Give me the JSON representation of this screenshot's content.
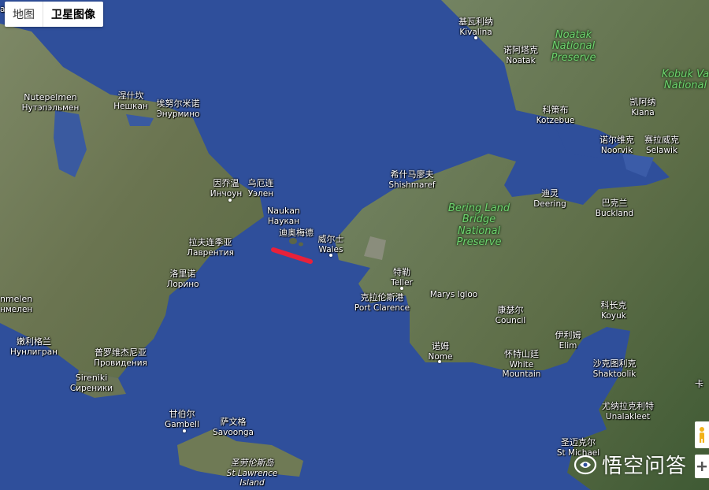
{
  "map_type_control": {
    "map_tab": "地图",
    "satellite_tab": "卫星图像",
    "active": "satellite"
  },
  "places": {
    "kivalina": {
      "zh": "基瓦利纳",
      "en": "Kivalina"
    },
    "noatak": {
      "zh": "诺阿塔克",
      "en": "Noatak"
    },
    "kotzebue": {
      "zh": "科策布",
      "en": "Kotzebue"
    },
    "kiana": {
      "zh": "凯阿纳",
      "en": "Kiana"
    },
    "noorvik": {
      "zh": "诺尔维克",
      "en": "Noorvik"
    },
    "selawik": {
      "zh": "赛拉威克",
      "en": "Selawik"
    },
    "shishmaref": {
      "zh": "希什马廖夫",
      "en": "Shishmaref"
    },
    "deering": {
      "zh": "迪灵",
      "en": "Deering"
    },
    "buckland": {
      "zh": "巴克兰",
      "en": "Buckland"
    },
    "wales": {
      "zh": "威尔士",
      "en": "Wales"
    },
    "teller": {
      "zh": "特勒",
      "en": "Teller"
    },
    "port_clarence": {
      "zh": "克拉伦斯港",
      "en": "Port Clarence"
    },
    "marys_igloo": {
      "zh": "",
      "en": "Marys Igloo"
    },
    "council": {
      "zh": "康瑟尔",
      "en": "Council"
    },
    "koyuk": {
      "zh": "科长克",
      "en": "Koyuk"
    },
    "elim": {
      "zh": "伊利姆",
      "en": "Elim"
    },
    "nome": {
      "zh": "诺姆",
      "en": "Nome"
    },
    "white_mountain": {
      "zh": "怀特山廷",
      "en": "White\nMountain"
    },
    "shaktoolik": {
      "zh": "沙克图利克",
      "en": "Shaktoolik"
    },
    "unalakleet": {
      "zh": "尤纳拉克利特",
      "en": "Unalakleet"
    },
    "st_michael": {
      "zh": "圣迈克尔",
      "en": "St Michael"
    },
    "nutepelmen": {
      "zh": "Nutepelmen",
      "en": "Нутэпэльмен"
    },
    "neshkan": {
      "zh": "涅什坎",
      "en": "Нешкан"
    },
    "enurmino": {
      "zh": "埃努尔米诺",
      "en": "Энурмино"
    },
    "inchoun": {
      "zh": "因乔温",
      "en": "Инчоун"
    },
    "uelen": {
      "zh": "乌厄连",
      "en": "Уэлен"
    },
    "naukan": {
      "zh": "Naukan",
      "en": "Наукан"
    },
    "diomede": {
      "zh": "迪奥梅德",
      "en": ""
    },
    "lavrentiya": {
      "zh": "拉夫连季亚",
      "en": "Лаврентия"
    },
    "lorino": {
      "zh": "洛里诺",
      "en": "Лорино"
    },
    "enmelen": {
      "zh": "nmelen",
      "en": "нмелен"
    },
    "nunligran": {
      "zh": "嫩利格兰",
      "en": "Нунлигран"
    },
    "provideniya": {
      "zh": "普罗维杰尼亚",
      "en": "Провидения"
    },
    "sireniki": {
      "zh": "Sireniki",
      "en": "Сиреники"
    },
    "gambell": {
      "zh": "甘伯尔",
      "en": "Gambell"
    },
    "savoonga": {
      "zh": "萨文格",
      "en": "Savoonga"
    },
    "st_lawrence": {
      "zh": "圣劳伦斯岛",
      "en": "St Lawrence\nIsland"
    },
    "left_edge": {
      "zh": "",
      "en": "a"
    },
    "right_edge": {
      "zh": "卡",
      "en": ""
    }
  },
  "parks": {
    "noatak": "Noatak\nNational\nPreserve",
    "kobuk": "Kobuk Va\nNational",
    "bering": "Bering Land\nBridge\nNational\nPreserve"
  },
  "watermark": {
    "text": "悟空问答"
  },
  "colors": {
    "ocean": "#2f4f9b",
    "land": "#6f7a55",
    "highlight": "#e8213a"
  }
}
